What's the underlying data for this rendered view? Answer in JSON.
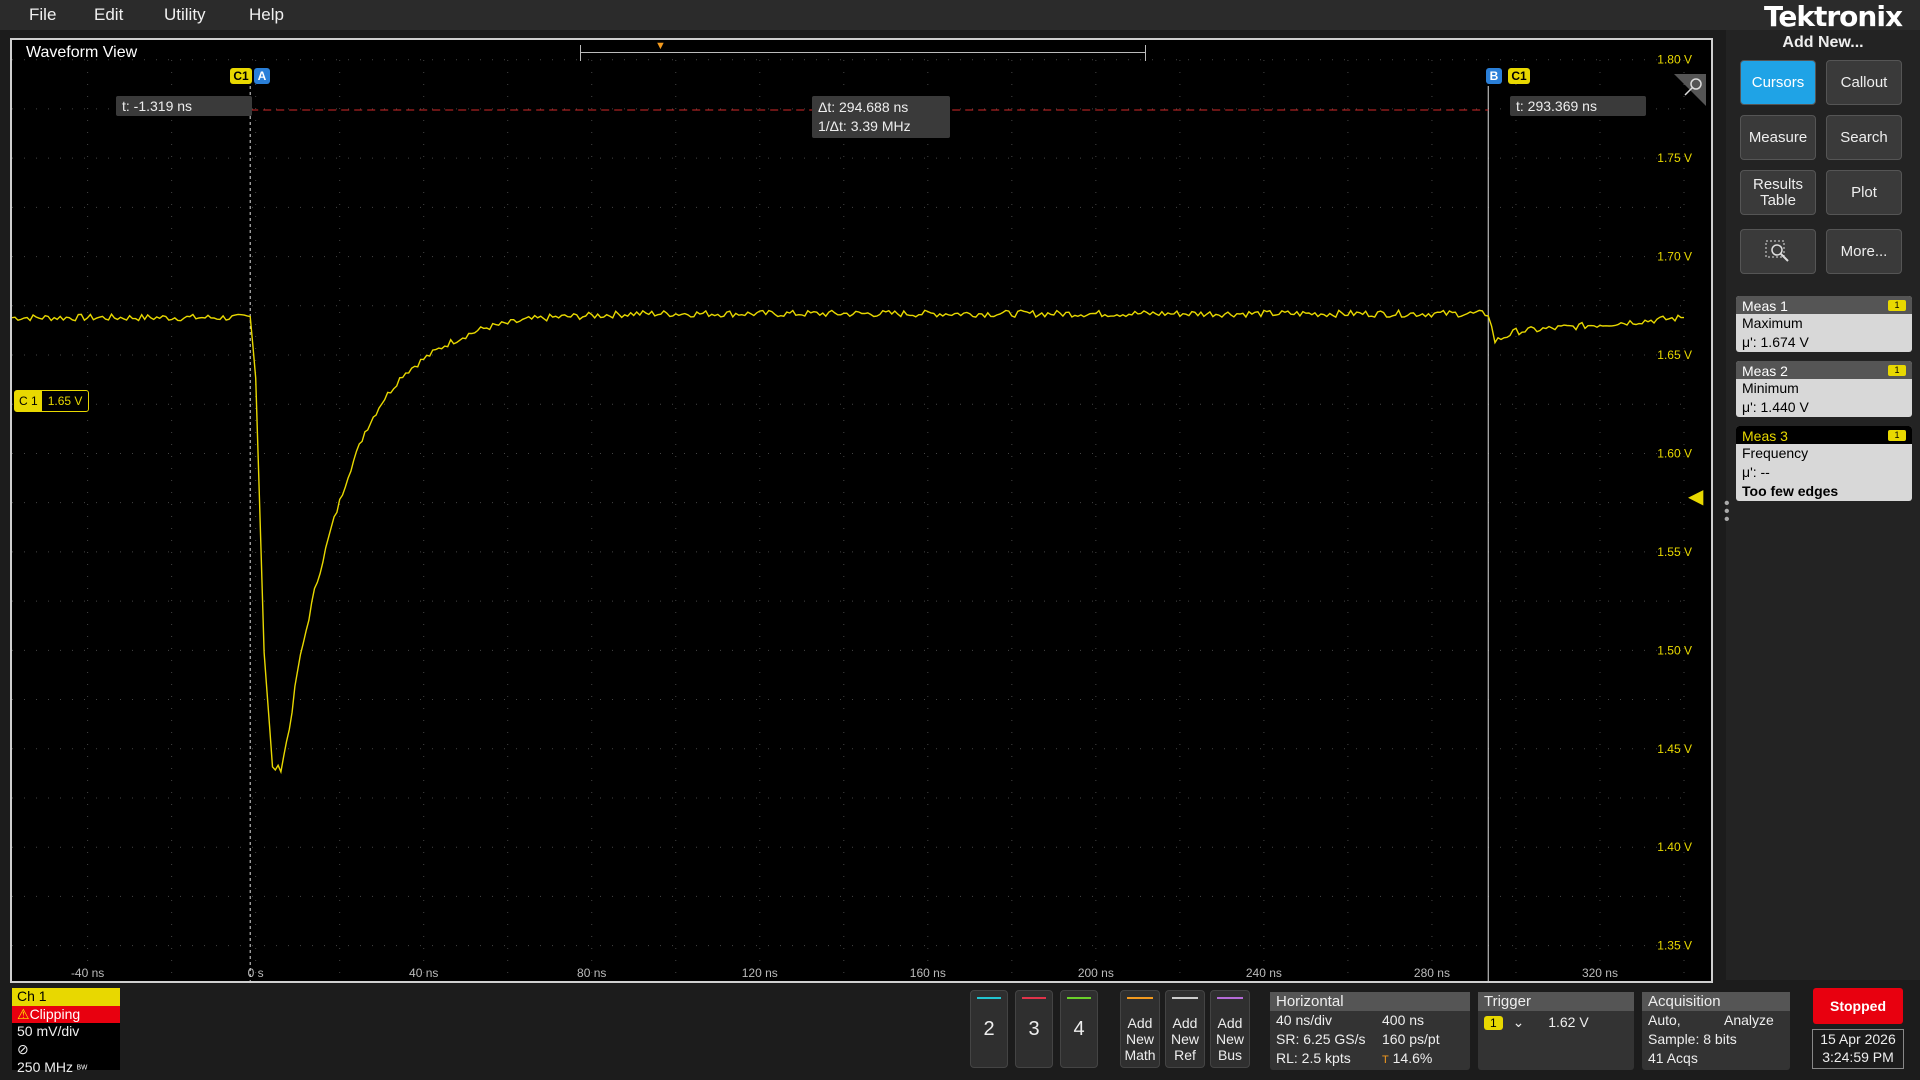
{
  "menu": {
    "file": "File",
    "edit": "Edit",
    "utility": "Utility",
    "help": "Help"
  },
  "brand": "Tektronix",
  "waveform_view": {
    "title": "Waveform View",
    "cursor_a_readout": "t: -1.319 ns",
    "cursor_b_readout": "t: 293.369 ns",
    "delta_t": "Δt: 294.688 ns",
    "inv_delta_t": "1/Δt: 3.39 MHz",
    "cursor_a_tag": "A",
    "cursor_b_tag": "B",
    "cursor_source": "C1",
    "ch1_label": "C 1",
    "ch1_level": "1.65 V",
    "y_ticks": [
      "1.80 V",
      "1.75 V",
      "1.70 V",
      "1.65 V",
      "1.60 V",
      "1.55 V",
      "1.50 V",
      "1.45 V",
      "1.40 V",
      "1.35 V"
    ],
    "x_ticks": [
      "-40 ns",
      "0 s",
      "40 ns",
      "80 ns",
      "120 ns",
      "160 ns",
      "200 ns",
      "240 ns",
      "280 ns",
      "320 ns"
    ]
  },
  "chart_data": {
    "type": "line",
    "x_unit": "ns",
    "y_unit": "V",
    "xlim": [
      -58,
      340
    ],
    "ylim": [
      1.33,
      1.81
    ],
    "series": [
      {
        "color": "#e8d800",
        "x": [
          -58,
          -1.3,
          0,
          2,
          4,
          6,
          8,
          10,
          14,
          18,
          22,
          26,
          30,
          35,
          40,
          45,
          50,
          55,
          60,
          65,
          70,
          80,
          90,
          100,
          120,
          150,
          200,
          250,
          293.4,
          295,
          300,
          340
        ],
        "y": [
          1.669,
          1.669,
          1.64,
          1.5,
          1.44,
          1.44,
          1.46,
          1.49,
          1.53,
          1.562,
          1.589,
          1.611,
          1.626,
          1.64,
          1.648,
          1.655,
          1.66,
          1.664,
          1.666,
          1.668,
          1.669,
          1.67,
          1.671,
          1.671,
          1.671,
          1.671,
          1.671,
          1.671,
          1.671,
          1.657,
          1.662,
          1.669
        ]
      }
    ]
  },
  "right_panel": {
    "add_new": "Add New...",
    "buttons": {
      "cursors": "Cursors",
      "callout": "Callout",
      "measure": "Measure",
      "search": "Search",
      "results_table_1": "Results",
      "results_table_2": "Table",
      "plot": "Plot",
      "more": "More..."
    },
    "meas": [
      {
        "title": "Meas 1",
        "badge": "1",
        "name": "Maximum",
        "value": "μ': 1.674 V"
      },
      {
        "title": "Meas 2",
        "badge": "1",
        "name": "Minimum",
        "value": "μ': 1.440 V"
      },
      {
        "title": "Meas 3",
        "badge": "1",
        "name": "Frequency",
        "value": "μ': --",
        "note": "Too few edges"
      }
    ]
  },
  "channel1": {
    "title": "Ch 1",
    "clipping": "Clipping",
    "scale": "50 mV/div",
    "bandwidth": "250 MHz"
  },
  "channel_buttons": [
    {
      "label": "2",
      "color": "#22c4d0"
    },
    {
      "label": "3",
      "color": "#e0334a"
    },
    {
      "label": "4",
      "color": "#6ad12a"
    }
  ],
  "add_buttons": [
    {
      "l1": "Add",
      "l2": "New",
      "l3": "Math",
      "color": "#f39a1e"
    },
    {
      "l1": "Add",
      "l2": "New",
      "l3": "Ref",
      "color": "#cccccc"
    },
    {
      "l1": "Add",
      "l2": "New",
      "l3": "Bus",
      "color": "#b46bd6"
    }
  ],
  "horizontal": {
    "title": "Horizontal",
    "scale": "40 ns/div",
    "duration": "400 ns",
    "sr": "SR: 6.25 GS/s",
    "res": "160 ps/pt",
    "rl": "RL: 2.5 kpts",
    "pos": "14.6%"
  },
  "trigger": {
    "title": "Trigger",
    "source": "1",
    "level": "1.62 V"
  },
  "acquisition": {
    "title": "Acquisition",
    "mode": "Auto,",
    "analyze": "Analyze",
    "sample": "Sample: 8 bits",
    "acqs": "41 Acqs"
  },
  "status": {
    "run": "Stopped",
    "date": "15 Apr 2026",
    "time": "3:24:59 PM"
  }
}
